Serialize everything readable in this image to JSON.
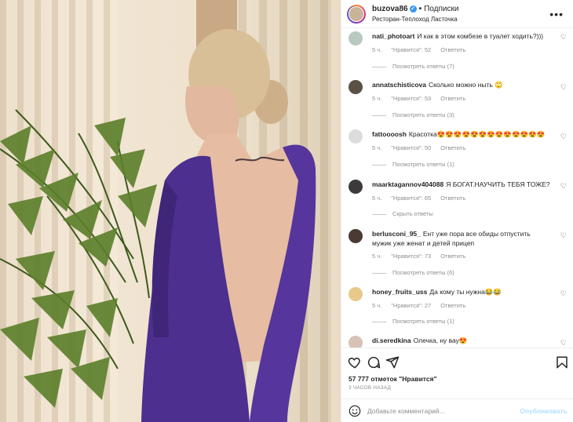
{
  "header": {
    "username": "buzovа86",
    "verified_mark": "✓",
    "dot": "•",
    "follow_label": "Подписки",
    "location": "Ресторан-Теплоход Ласточка",
    "more_icon": "more-horizontal-icon"
  },
  "comments": [
    {
      "username": "nati_photoart",
      "text": "И как в этом комбезе в туалет ходить?)))",
      "time": "5 ч.",
      "likes": "\"Нравится\": 52",
      "reply": "Ответить",
      "replies": "Посмотреть ответы (7)",
      "avatar_color": "#b9c9c0"
    },
    {
      "username": "annatschistiсova",
      "text": "Сколько можно ныть 🙄",
      "time": "5 ч.",
      "likes": "\"Нравится\": 53",
      "reply": "Ответить",
      "replies": "Посмотреть ответы (3)",
      "avatar_color": "#5b5044"
    },
    {
      "username": "fattoooosh",
      "text": "Красотка😍😍😍😍😍😍😍😍😍😍😍😍😍",
      "time": "5 ч.",
      "likes": "\"Нравится\": 50",
      "reply": "Ответить",
      "replies": "Посмотреть ответы (1)",
      "avatar_color": "#dcdcdc"
    },
    {
      "username": "maarktagannov404088",
      "text": "Я БОГАТ.НАУЧИТЬ ТЕБЯ ТОЖЕ?",
      "time": "5 ч.",
      "likes": "\"Нравится\": 65",
      "reply": "Ответить",
      "replies": "Скрыть ответы",
      "avatar_color": "#3c3a3a"
    },
    {
      "username": "berlusconi_95_",
      "text": "Ент уже пора все обиды отпустить мужик уже женат и детей прицеп",
      "time": "5 ч.",
      "likes": "\"Нравится\": 73",
      "reply": "Ответить",
      "replies": "Посмотреть ответы (6)",
      "avatar_color": "#4a3a36"
    },
    {
      "username": "honey_fruits_uss",
      "text": "Да кому ты нужна😂😂",
      "time": "5 ч.",
      "likes": "\"Нравится\": 27",
      "reply": "Ответить",
      "replies": "Посмотреть ответы (1)",
      "avatar_color": "#e8c98a"
    },
    {
      "username": "di.seredkina",
      "text": "Олечка, ну вау😍",
      "avatar_color": "#d6c2b6"
    }
  ],
  "likes_text": "57 777 отметок \"Нравится\"",
  "time_ago": "3 ЧАСОВ НАЗАД",
  "add_comment": {
    "placeholder": "Добавьте комментарий...",
    "publish_label": "Опубликовать"
  },
  "icons": {
    "heart": "heart-icon",
    "comment": "comment-icon",
    "share": "share-icon",
    "save": "bookmark-icon",
    "emoji": "emoji-icon",
    "like_small": "heart-outline-icon"
  },
  "colors": {
    "publish_disabled": "#b2dffc",
    "meta_gray": "#8e8e8e",
    "verified_blue": "#3897f0"
  }
}
